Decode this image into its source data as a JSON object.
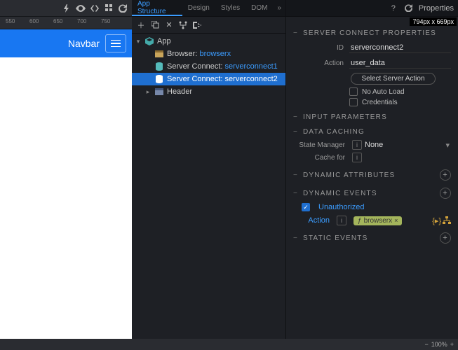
{
  "preview": {
    "dim_badge": "794px x 669px",
    "navbar_title": "Navbar",
    "zoom": "100%",
    "ruler_ticks": [
      "550",
      "600",
      "650",
      "700",
      "750"
    ]
  },
  "tabs": {
    "items": [
      "App Structure",
      "Design",
      "Styles",
      "DOM"
    ],
    "active": 0
  },
  "tree": {
    "root": "App",
    "nodes": [
      {
        "label": "Browser:",
        "id": "browserx",
        "icon": "browser"
      },
      {
        "label": "Server Connect:",
        "id": "serverconnect1",
        "icon": "db"
      },
      {
        "label": "Server Connect:",
        "id": "serverconnect2",
        "icon": "db",
        "selected": true
      },
      {
        "label": "Header",
        "id": "",
        "icon": "header"
      }
    ]
  },
  "right": {
    "title": "Properties",
    "sections": {
      "scp": {
        "title": "SERVER CONNECT PROPERTIES",
        "id_label": "ID",
        "id_value": "serverconnect2",
        "action_label": "Action",
        "action_value": "user_data",
        "select_btn": "Select Server Action",
        "no_auto": "No Auto Load",
        "credentials": "Credentials"
      },
      "input": {
        "title": "INPUT PARAMETERS"
      },
      "cache": {
        "title": "DATA CACHING",
        "state_label": "State Manager",
        "state_value": "None",
        "cache_label": "Cache for"
      },
      "dynattr": {
        "title": "DYNAMIC ATTRIBUTES"
      },
      "dynevt": {
        "title": "DYNAMIC EVENTS",
        "unauthorized": "Unauthorized",
        "action_label": "Action",
        "pill_prefix": "ƒ",
        "pill_value": "browserx"
      },
      "statevt": {
        "title": "STATIC EVENTS"
      }
    }
  }
}
